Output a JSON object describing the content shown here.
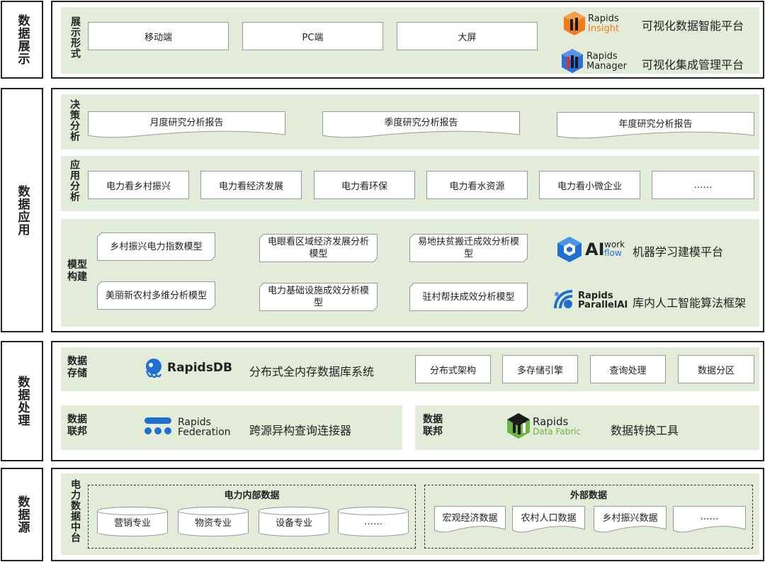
{
  "layers": {
    "display": "数据展示",
    "application": "数据应用",
    "processing": "数据处理",
    "source": "数据源"
  },
  "display": {
    "label": "展示形式",
    "forms": [
      "移动端",
      "PC端",
      "大屏"
    ],
    "platforms": [
      {
        "logo_line1": "Rapids",
        "logo_line2": "Insight",
        "name": "可视化数据智能平台"
      },
      {
        "logo_line1": "Rapids",
        "logo_line2": "Manager",
        "name": "可视化集成管理平台"
      }
    ]
  },
  "application": {
    "decision_label": "决策分析",
    "reports": [
      "月度研究分析报告",
      "季度研究分析报告",
      "年度研究分析报告"
    ],
    "app_label": "应用分析",
    "apps": [
      "电力看乡村振兴",
      "电力看经济发展",
      "电力看环保",
      "电力看水资源",
      "电力看小微企业",
      "……"
    ],
    "model_label": "模型构建",
    "models": [
      "乡村振兴电力指数模型",
      "电眼看区域经济发展分析模型",
      "易地扶贫搬迁成效分析模型",
      "美丽新农村多维分析模型",
      "电力基础设施成效分析模型",
      "驻村帮扶成效分析模型"
    ],
    "ai_logo": {
      "big": "AI",
      "top": "work",
      "bottom": "flow"
    },
    "ai_name": "机器学习建模平台",
    "parallel_logo": {
      "line1": "Rapids",
      "line2": "ParallelAI"
    },
    "parallel_name": "库内人工智能算法框架"
  },
  "processing": {
    "storage_label": "数据存储",
    "db_logo": "RapidsDB",
    "db_name": "分布式全内存数据库系统",
    "features": [
      "分布式架构",
      "多存储引擎",
      "查询处理",
      "数据分区"
    ],
    "fed_label": "数据联邦",
    "fed_logo": {
      "line1": "Rapids",
      "line2": "Federation"
    },
    "fed_name": "跨源异构查询连接器",
    "fabric_label": "数据联邦",
    "fabric_logo": {
      "line1": "Rapids",
      "line2": "Data Fabric"
    },
    "fabric_name": "数据转换工具"
  },
  "source": {
    "label": "电力数据中台",
    "internal_title": "电力内部数据",
    "internal": [
      "营销专业",
      "物资专业",
      "设备专业",
      "……"
    ],
    "external_title": "外部数据",
    "external": [
      "宏观经济数据",
      "农村人口数据",
      "乡村振兴数据",
      "……"
    ]
  },
  "colors": {
    "band": "#e2ecd9",
    "insight_orange": "#f07c1c",
    "manager_blue": "#2c6fd6",
    "db_blue": "#1f6fd1",
    "fabric_green": "#6cb33f"
  }
}
